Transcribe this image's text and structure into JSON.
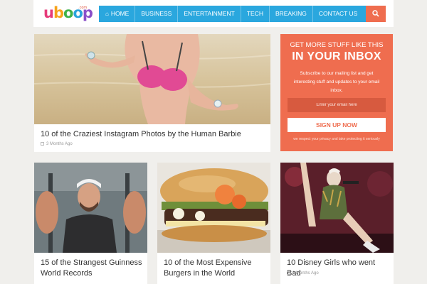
{
  "header": {
    "logo_letters": [
      "u",
      "b",
      "o",
      "o",
      "p"
    ],
    "logo_sub": ".com",
    "nav": [
      {
        "label": "HOME",
        "icon": "home-icon"
      },
      {
        "label": "BUSINESS"
      },
      {
        "label": "ENTERTAINMENT"
      },
      {
        "label": "TECH"
      },
      {
        "label": "BREAKING"
      },
      {
        "label": "CONTACT US"
      }
    ],
    "search_icon": "search-icon"
  },
  "featured": {
    "title": "10 of the Craziest Instagram Photos by the Human Barbie",
    "meta": "3 Months Ago"
  },
  "newsletter": {
    "heading_small": "GET MORE STUFF LIKE THIS",
    "heading_large": "IN YOUR INBOX",
    "description": "Subscribe to our mailing list and get interesting stuff and updates to your email inbox.",
    "email_placeholder": "Enter your email here",
    "button_label": "SIGN UP NOW",
    "privacy": "we respect your privacy and take protecting it seriously"
  },
  "articles": [
    {
      "title": "15 of the Strangest Guinness World Records",
      "meta": ""
    },
    {
      "title": "10 of the Most Expensive Burgers in the World",
      "meta": ""
    },
    {
      "title": "10 Disney Girls who went Bad",
      "meta": "3 Months Ago"
    }
  ],
  "colors": {
    "nav_blue": "#2aa7de",
    "accent_orange": "#ef6d4f",
    "background": "#f0efec"
  }
}
